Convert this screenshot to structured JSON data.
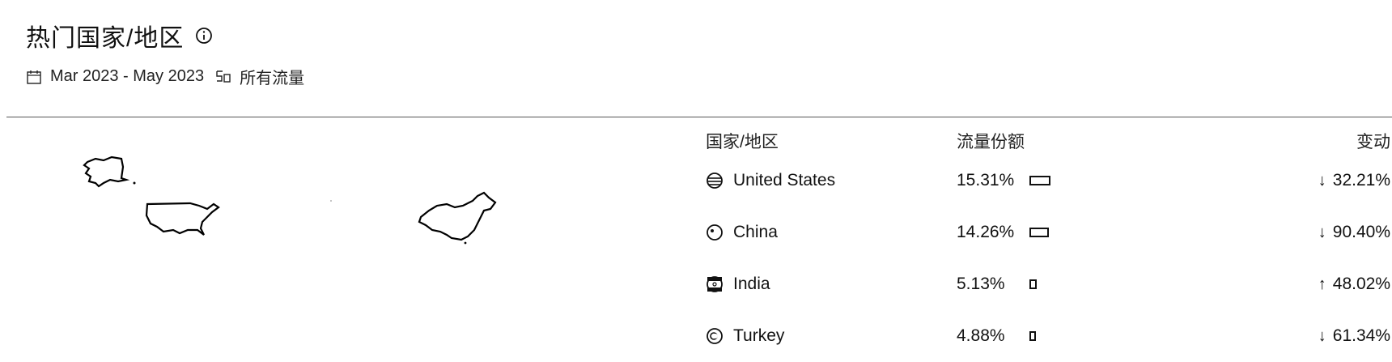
{
  "header": {
    "title": "热门国家/地区",
    "info_icon": "info-circle-icon",
    "date_range": "Mar 2023 - May 2023",
    "date_icon": "calendar-icon",
    "traffic_icon": "traffic-source-icon",
    "traffic_filter": "所有流量"
  },
  "table": {
    "col_country": "国家/地区",
    "col_share": "流量份额",
    "col_change": "变动",
    "rows": [
      {
        "country": "United States",
        "flag_icon": "us-flag-icon",
        "share": "15.31%",
        "share_value": 15.31,
        "direction": "down",
        "arrow": "↓",
        "change": "32.21%"
      },
      {
        "country": "China",
        "flag_icon": "china-flag-icon",
        "share": "14.26%",
        "share_value": 14.26,
        "direction": "down",
        "arrow": "↓",
        "change": "90.40%"
      },
      {
        "country": "India",
        "flag_icon": "india-flag-icon",
        "share": "5.13%",
        "share_value": 5.13,
        "direction": "up",
        "arrow": "↑",
        "change": "48.02%"
      },
      {
        "country": "Turkey",
        "flag_icon": "turkey-flag-icon",
        "share": "4.88%",
        "share_value": 4.88,
        "direction": "down",
        "arrow": "↓",
        "change": "61.34%"
      }
    ]
  },
  "colors": {
    "text": "#111111",
    "divider": "#555555",
    "background": "#ffffff"
  }
}
